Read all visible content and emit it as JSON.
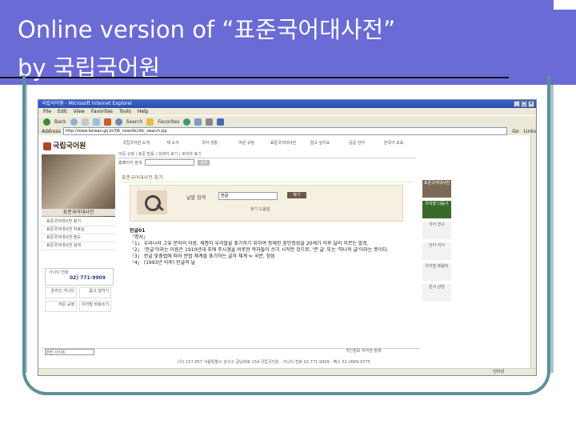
{
  "slide": {
    "title_line1": "Online version of “표준국어대사전”",
    "title_line2": "by 국립국어원"
  },
  "browser": {
    "window_title": "국립국어원 - Microsoft Internet Explorer",
    "menu": [
      "File",
      "Edit",
      "View",
      "Favorites",
      "Tools",
      "Help"
    ],
    "toolbar": {
      "back": "Back",
      "search": "Search",
      "favorites": "Favorites"
    },
    "address_label": "Address",
    "address_value": "http://www.korean.go.kr/06_new/dic/dic_search.jsp",
    "go_label": "Go",
    "links_label": "Links",
    "status_text": "인터넷"
  },
  "site": {
    "logo": "국립국어원",
    "nav": [
      "국립국어원 소개",
      "새 소식",
      "국어 생활",
      "어문 규정",
      "표준국어대사전",
      "알고 싶어요",
      "공공 언어",
      "한국어 교육"
    ],
    "subnav": "어문 규정 | 표준 발음 | 외래어 표기 | 로마자 표기",
    "search_strip_label": "홈페이지 검색",
    "search_strip_button": "검색",
    "left_label": "표준국어대사전",
    "left_menu": [
      "표준국어대사전 찾기",
      "표준국어대사전 자료실",
      "표준국어대사전 정오",
      "표준국어대사전 검색"
    ],
    "phone_label": "가나다 전화",
    "phone_number": "02) 771-9909",
    "quick_icons": [
      "온라인 가나다",
      "묻고 답하기",
      "어문 규정",
      "우리말 바로쓰기"
    ],
    "panel_title": "표준국어대사전 찾기",
    "search_label": "낱말 검색",
    "search_input_value": "한글",
    "search_button": "찾기",
    "search_sub": "찾기 도움말",
    "result_lines": [
      "한글01",
      "「명사」",
      "「1」 우리나라 고유 문자의 이름. 세종이 우리말을 표기하기 위하여 창제한 훈민정음을 20세기 이후 달리 이르는 말로,",
      "「2」 '한글'이라는 이름은 1910년대 초에 주시경을 비롯한 학자들이 쓰기 시작한 것으로, '큰 글' 또는 '하나의 글'이라는 뜻이다.",
      "「3」 한글 맞춤법에 따라 문법 체계를 표기하는 글자 체계 ≒ 국문, 정음",
      "「4」 (1993년 이후) 한글의 날"
    ],
    "right_column": [
      "표준국어대사전",
      "우리말 다듬기",
      "국어 연구",
      "언어 지식",
      "우리말 배움터",
      "문서 상담"
    ],
    "footer_select": "관련 사이트",
    "footer_links": [
      "개인정보",
      "저작권 정책"
    ],
    "footer_address": "(우) 157-857 서울특별시 강서구 금낭화로 154 국립국어원 · 가나다 전화 02-771-9909 · 팩스 02-2669-9775"
  }
}
